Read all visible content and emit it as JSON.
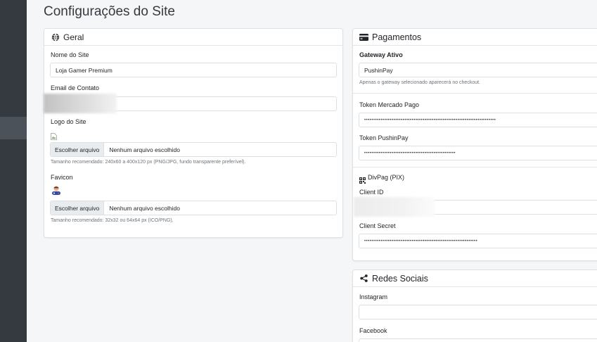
{
  "page": {
    "title": "Configurações do Site"
  },
  "geral": {
    "header": "Geral",
    "site_name_label": "Nome do Site",
    "site_name_value": "Loja Gamer Premium",
    "email_label": "Email de Contato",
    "logo_label": "Logo do Site",
    "logo_button": "Escolher arquivo",
    "logo_file": "Nenhum arquivo escolhido",
    "logo_help": "Tamanho recomendado: 240x60 a 400x120 px (PNG/JPG, fundo transparente preferível).",
    "favicon_label": "Favicon",
    "favicon_button": "Escolher arquivo",
    "favicon_file": "Nenhum arquivo escolhido",
    "favicon_help": "Tamanho recomendado: 32x32 ou 64x64 px (ICO/PNG)."
  },
  "pagamentos": {
    "header": "Pagamentos",
    "gateway_label": "Gateway Ativo",
    "gateway_value": "PushinPay",
    "gateway_help": "Apenas o gateway selecionado aparecerá no checkout.",
    "mp_token_label": "Token Mercado Pago",
    "mp_token_value": "••••••••••••••••••••••••••••••••••••••••••••••••••••••••••••••••••••••••",
    "pushinpay_token_label": "Token PushinPay",
    "pushinpay_token_value": "••••••••••••••••••••••••••••••••••••••••••••••••••",
    "divpag_header": "DivPag (PIX)",
    "client_id_label": "Client ID",
    "client_secret_label": "Client Secret",
    "client_secret_value": "••••••••••••••••••••••••••••••••••••••••••••••••••••••••••••••"
  },
  "redes": {
    "header": "Redes Sociais",
    "instagram_label": "Instagram",
    "facebook_label": "Facebook"
  }
}
